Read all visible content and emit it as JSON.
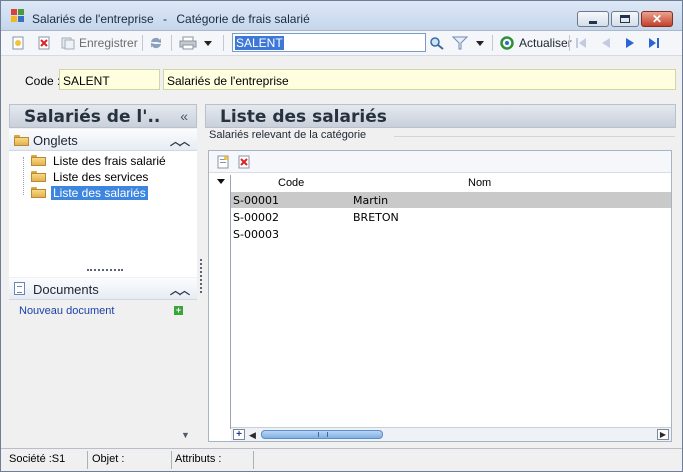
{
  "window": {
    "title": "Salariés de l'entreprise",
    "subtitle": "Catégorie de frais salarié",
    "minimize_icon": "minimize-icon",
    "maximize_icon": "maximize-icon",
    "close_icon": "close-icon"
  },
  "toolbar": {
    "new_icon": "new-document-icon",
    "delete_icon": "delete-icon",
    "save_label": "Enregistrer",
    "refresh_icon": "refresh-icon",
    "print_icon": "printer-icon",
    "search_value": "SALENT",
    "search_icon": "magnifier-icon",
    "filter_icon": "filter-icon",
    "refresh_label": "Actualiser",
    "nav_icons": [
      "first-icon",
      "prev-icon",
      "next-icon",
      "last-icon"
    ]
  },
  "header": {
    "code_label": "Code :",
    "code_value": "SALENT",
    "description": "Salariés de l'entreprise"
  },
  "left_panel": {
    "title": "Salariés de l'..",
    "collapse_glyph": "«",
    "onglets": {
      "label": "Onglets",
      "items": [
        {
          "label": "Liste des frais salarié"
        },
        {
          "label": "Liste des services"
        },
        {
          "label": "Liste des salariés",
          "selected": true
        }
      ]
    },
    "documents": {
      "label": "Documents",
      "new_document": "Nouveau document"
    }
  },
  "right_panel": {
    "title": "Liste des salariés",
    "group_label": "Salariés relevant de la catégorie",
    "columns": [
      "Code",
      "Nom"
    ],
    "rows": [
      {
        "code": "S-00001",
        "nom": "Martin",
        "selected": true
      },
      {
        "code": "S-00002",
        "nom": "BRETON"
      },
      {
        "code": "S-00003",
        "nom": ""
      }
    ]
  },
  "statusbar": {
    "societe": "Société :S1",
    "objet": "Objet :",
    "attributs": "Attributs :"
  },
  "colors": {
    "selection": "#3d86df",
    "field_background": "#ffffe0",
    "selected_row": "#c9c9c9"
  }
}
